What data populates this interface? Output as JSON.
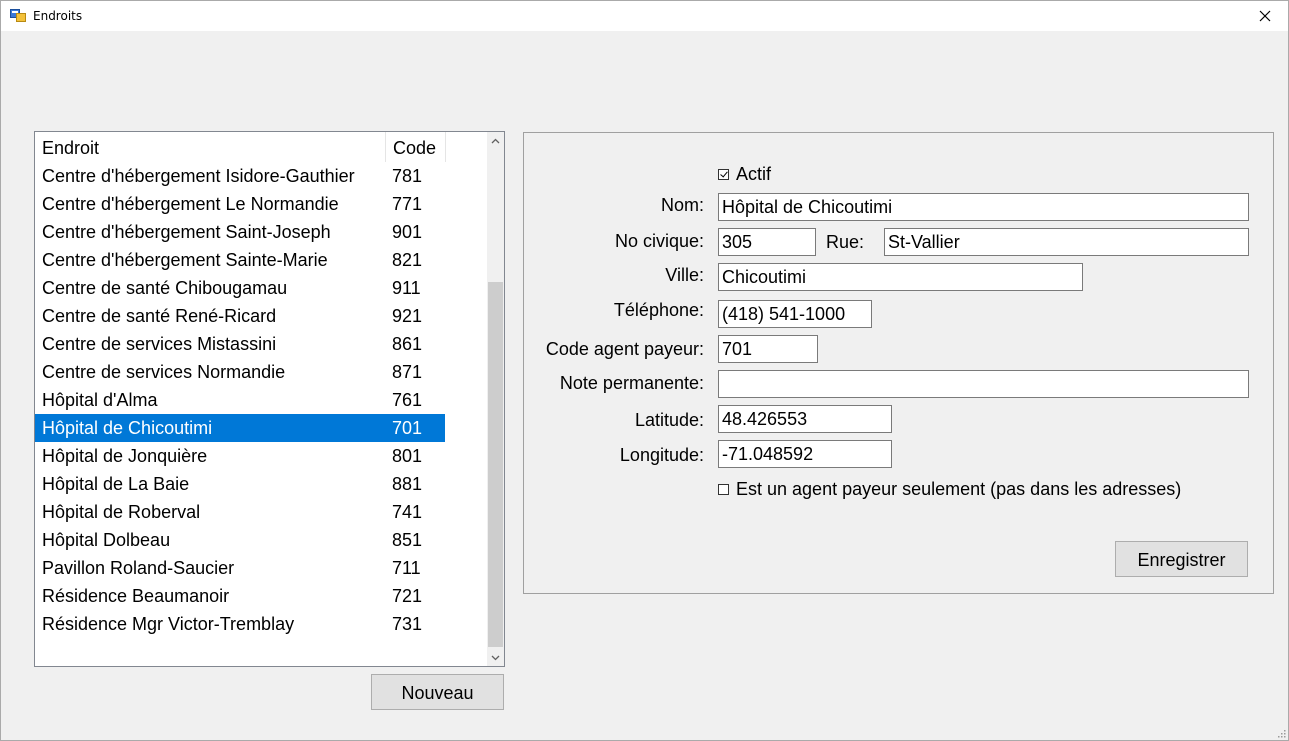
{
  "window": {
    "title": "Endroits"
  },
  "list": {
    "columns": {
      "name": "Endroit",
      "code": "Code"
    },
    "rows": [
      {
        "name": "Centre d'hébergement Isidore-Gauthier",
        "code": "781"
      },
      {
        "name": "Centre d'hébergement Le Normandie",
        "code": "771"
      },
      {
        "name": "Centre d'hébergement Saint-Joseph",
        "code": "901"
      },
      {
        "name": "Centre d'hébergement Sainte-Marie",
        "code": "821"
      },
      {
        "name": "Centre de santé Chibougamau",
        "code": "911"
      },
      {
        "name": "Centre de santé René-Ricard",
        "code": "921"
      },
      {
        "name": "Centre de services Mistassini",
        "code": "861"
      },
      {
        "name": "Centre de services Normandie",
        "code": "871"
      },
      {
        "name": "Hôpital d'Alma",
        "code": "761"
      },
      {
        "name": "Hôpital de Chicoutimi",
        "code": "701"
      },
      {
        "name": "Hôpital de Jonquière",
        "code": "801"
      },
      {
        "name": "Hôpital de La Baie",
        "code": "881"
      },
      {
        "name": "Hôpital de Roberval",
        "code": "741"
      },
      {
        "name": "Hôpital Dolbeau",
        "code": "851"
      },
      {
        "name": "Pavillon Roland-Saucier",
        "code": "711"
      },
      {
        "name": "Résidence Beaumanoir",
        "code": "721"
      },
      {
        "name": "Résidence Mgr Victor-Tremblay",
        "code": "731"
      }
    ],
    "selected_index": 9
  },
  "buttons": {
    "new_label": "Nouveau",
    "save_label": "Enregistrer"
  },
  "form": {
    "actif": {
      "label": "Actif",
      "checked": true
    },
    "nom": {
      "label": "Nom:",
      "value": "Hôpital de Chicoutimi"
    },
    "no_civique": {
      "label": "No civique:",
      "value": "305"
    },
    "rue": {
      "label": "Rue:",
      "value": "St-Vallier"
    },
    "ville": {
      "label": "Ville:",
      "value": "Chicoutimi"
    },
    "telephone": {
      "label": "Téléphone:",
      "value": "(418) 541-1000"
    },
    "code_agent": {
      "label": "Code agent payeur:",
      "value": "701"
    },
    "note": {
      "label": "Note permanente:",
      "value": ""
    },
    "latitude": {
      "label": "Latitude:",
      "value": "48.426553"
    },
    "longitude": {
      "label": "Longitude:",
      "value": "-71.048592"
    },
    "agent_seulement": {
      "label": "Est un agent payeur seulement (pas dans les adresses)",
      "checked": false
    }
  },
  "colors": {
    "selection": "#0078d7",
    "window_bg": "#f0f0f0",
    "button_bg": "#e1e1e1"
  },
  "icons": {
    "app": "window-app-icon",
    "close": "close-icon",
    "scroll_up": "chevron-up-icon",
    "scroll_down": "chevron-down-icon"
  }
}
